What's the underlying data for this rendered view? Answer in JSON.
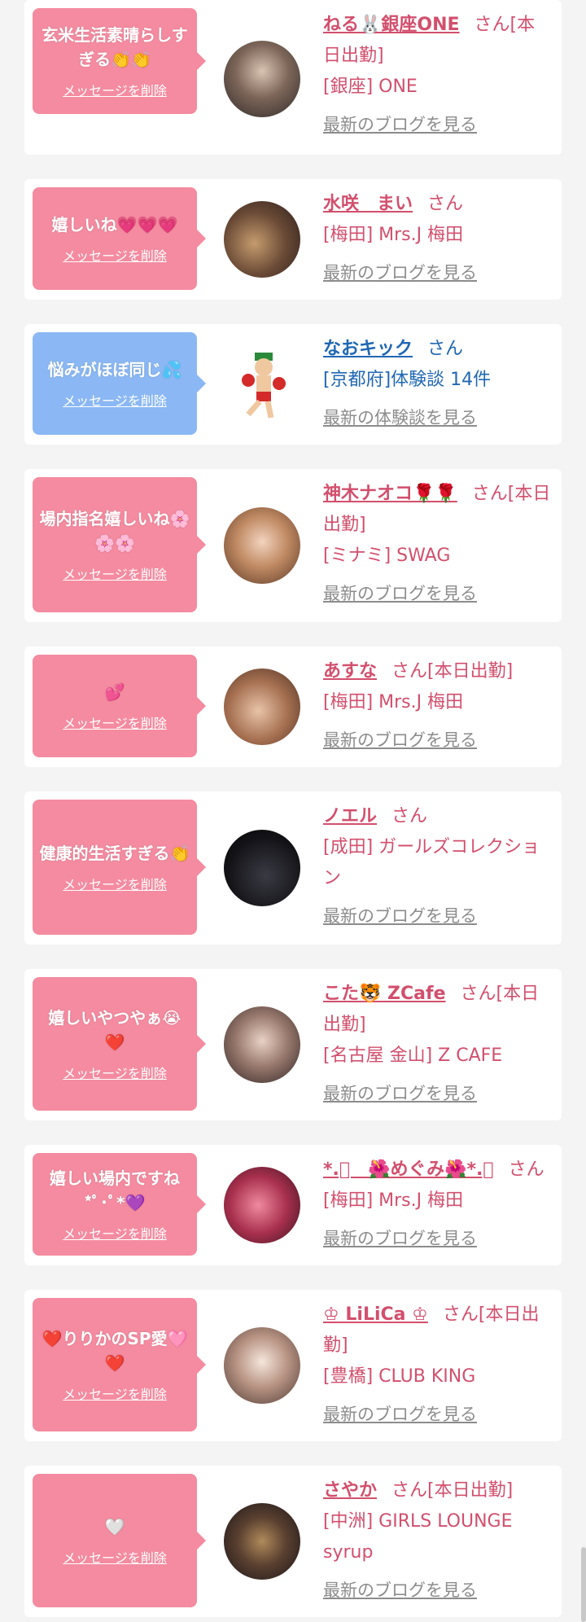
{
  "delete_label": "メッセージを削除",
  "cards": [
    {
      "message": "玄米生活素晴らしすぎる👏👏",
      "name": "ねる🐰銀座ONE",
      "san": "さん[本日出勤]",
      "shop": "[銀座] ONE",
      "blog": "最新のブログを見る"
    },
    {
      "message": "嬉しいね💗💗💗",
      "name": "水咲　まい",
      "san": "さん",
      "shop": "[梅田] Mrs.J 梅田",
      "blog": "最新のブログを見る"
    },
    {
      "message": "悩みがほぼ同じ💦",
      "name": "なおキック",
      "san": "さん",
      "shop": "[京都府]体験談 14件",
      "blog": "最新の体験談を見る"
    },
    {
      "message": "場内指名嬉しいね🌸🌸🌸",
      "name": "神木ナオコ🌹🌹",
      "san": "さん[本日出勤]",
      "shop": "[ミナミ] SWAG",
      "blog": "最新のブログを見る"
    },
    {
      "message": "💕",
      "name": "あすな",
      "san": "さん[本日出勤]",
      "shop": "[梅田] Mrs.J 梅田",
      "blog": "最新のブログを見る"
    },
    {
      "message": "健康的生活すぎる👏",
      "name": "ノエル",
      "san": "さん",
      "shop": "[成田] ガールズコレクション",
      "blog": "最新のブログを見る"
    },
    {
      "message": "嬉しいやつやぁ😭❤️",
      "name": "こた🐯 ZCafe",
      "san": "さん[本日出勤]",
      "shop": "[名古屋 金山] Z CAFE",
      "blog": "最新のブログを見る"
    },
    {
      "message": "嬉しい場内ですね*ﾟ･ﾟ*💜",
      "name": "*.ﾟ　🌺めぐみ🌺*.ﾟ",
      "san": "さん",
      "shop": "[梅田] Mrs.J 梅田",
      "blog": "最新のブログを見る"
    },
    {
      "message": "❤️りりかのSP愛🩷❤️",
      "name": "♔ LiLiCa ♔",
      "san": "さん[本日出勤]",
      "shop": "[豊橋] CLUB KING",
      "blog": "最新のブログを見る"
    },
    {
      "message": "🤍",
      "name": "さやか",
      "san": "さん[本日出勤]",
      "shop": "[中洲] GIRLS LOUNGE syrup",
      "blog": "最新のブログを見る"
    }
  ]
}
